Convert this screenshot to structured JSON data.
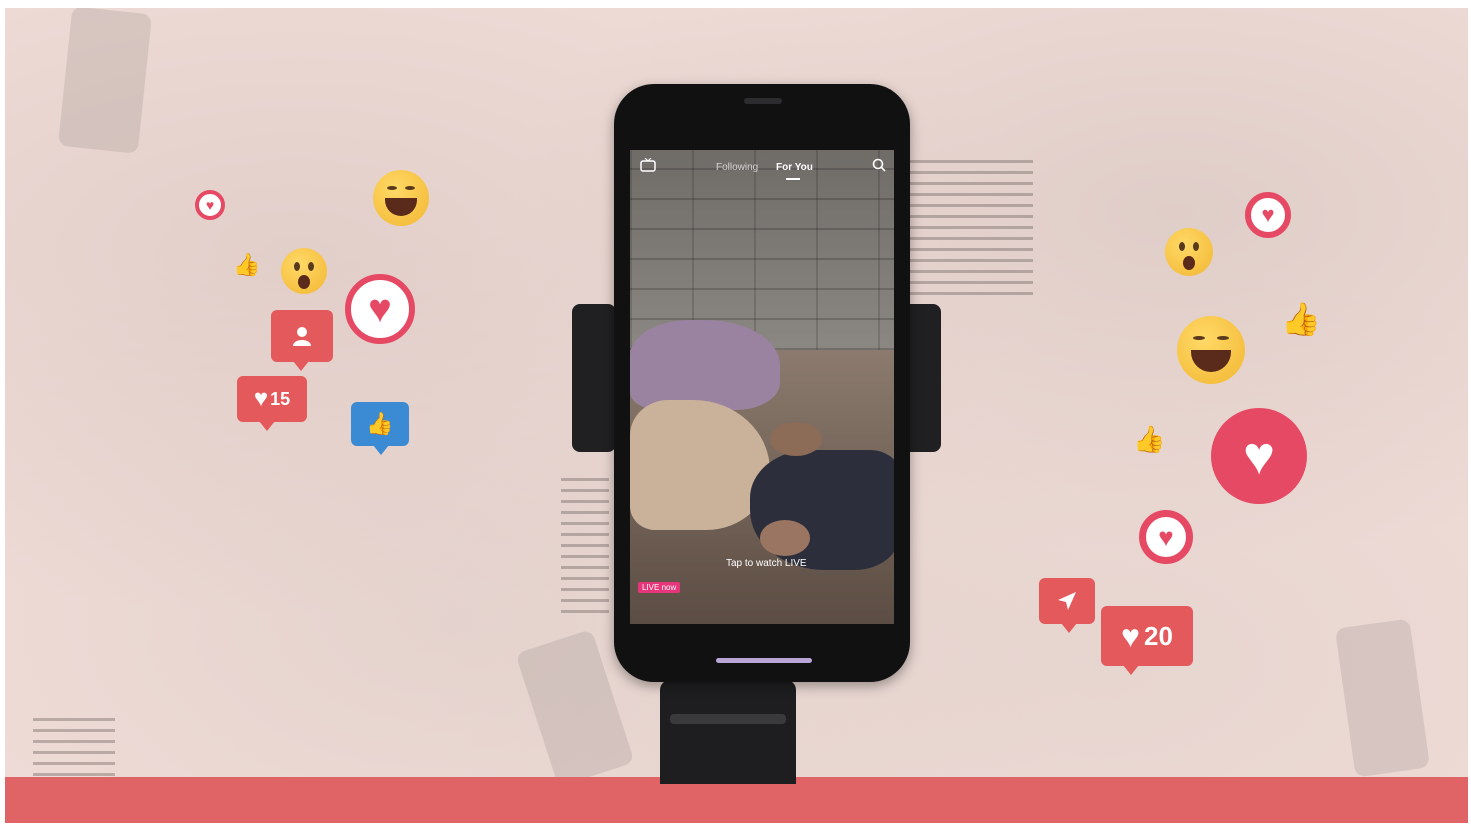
{
  "screen": {
    "tabs": [
      "Following",
      "For You"
    ],
    "tap_text": "Tap to watch LIVE",
    "live_badge": "LIVE now"
  },
  "reactions_left": {
    "heart_count": "15"
  },
  "reactions_right": {
    "heart_count": "20"
  },
  "colors": {
    "background": "#f1ddd8",
    "bottom_bar": "#e06466",
    "heart_red": "#e64963",
    "bubble_red": "#e45a5c",
    "like_blue": "#3a8ad4",
    "emoji_yellow": "#f2b632"
  },
  "icons": {
    "screen_top_left": "live-tv-icon",
    "screen_top_right": "search-icon"
  }
}
